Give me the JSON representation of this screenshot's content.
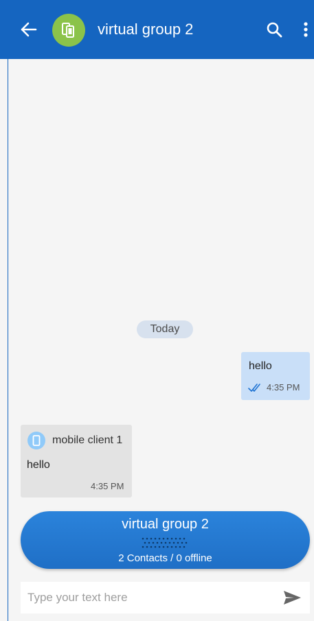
{
  "header": {
    "title": "virtual group 2",
    "back_icon": "arrow-left-icon",
    "avatar_icon": "mobile-devices-icon",
    "search_icon": "search-icon",
    "more_icon": "more-vert-icon",
    "color": "#1565c0",
    "avatar_color": "#8bc34a"
  },
  "chat": {
    "date_separator": "Today",
    "messages": [
      {
        "direction": "outgoing",
        "text": "hello",
        "time": "4:35 PM",
        "status_icon": "double-check-icon"
      },
      {
        "direction": "incoming",
        "sender": "mobile client 1",
        "sender_icon": "mobile-icon",
        "text": "hello",
        "time": "4:35 PM"
      }
    ]
  },
  "group_banner": {
    "title": "virtual group 2",
    "subtitle": "2 Contacts / 0 offline",
    "grip_icon": "drag-handle-icon"
  },
  "composer": {
    "placeholder": "Type your text here",
    "value": "",
    "send_icon": "send-icon"
  }
}
